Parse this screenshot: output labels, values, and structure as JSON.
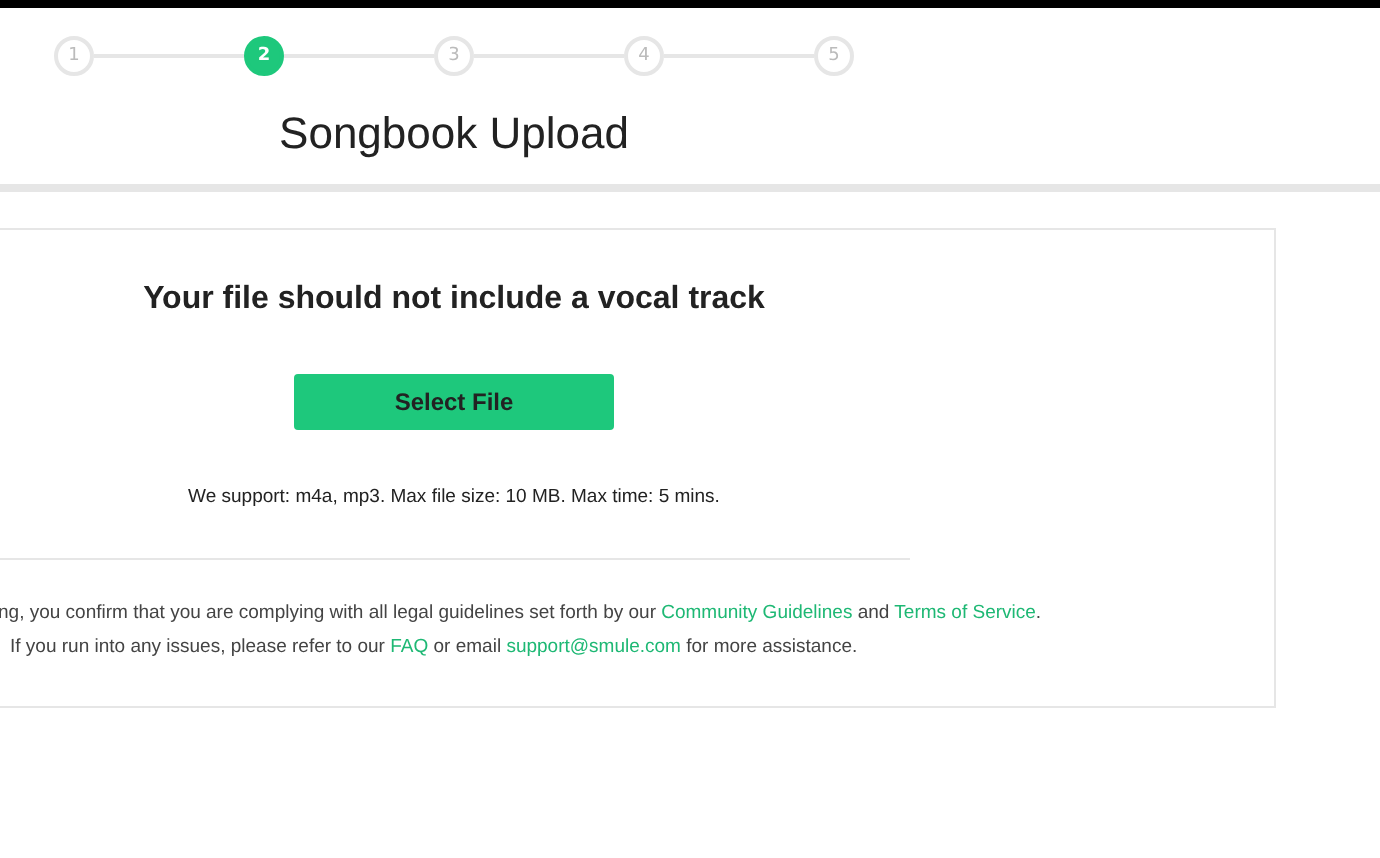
{
  "steps": [
    {
      "label": "1",
      "selected": false
    },
    {
      "label": "2",
      "selected": true
    },
    {
      "label": "3",
      "selected": false
    },
    {
      "label": "4",
      "selected": false
    },
    {
      "label": "5",
      "selected": false
    }
  ],
  "title": "Songbook Upload",
  "upload": {
    "heading": "Your file should not include a vocal track",
    "button": "Select File",
    "support": "We support: m4a, mp3. Max file size: 10 MB. Max time: 5 mins."
  },
  "legal": [
    [
      {
        "kind": "text",
        "text": "ng, you confirm that you are complying with all legal guidelines set forth by our "
      },
      {
        "kind": "link",
        "text": "Community Guidelines"
      },
      {
        "kind": "text",
        "text": " and "
      },
      {
        "kind": "link",
        "text": "Terms of Service"
      },
      {
        "kind": "text",
        "text": "."
      }
    ],
    [
      {
        "kind": "text",
        "text": "If you run into any issues, please refer to our "
      },
      {
        "kind": "link",
        "text": "FAQ"
      },
      {
        "kind": "text",
        "text": " or email "
      },
      {
        "kind": "link",
        "text": "support@smule.com"
      },
      {
        "kind": "text",
        "text": " for more assistance."
      }
    ]
  ]
}
